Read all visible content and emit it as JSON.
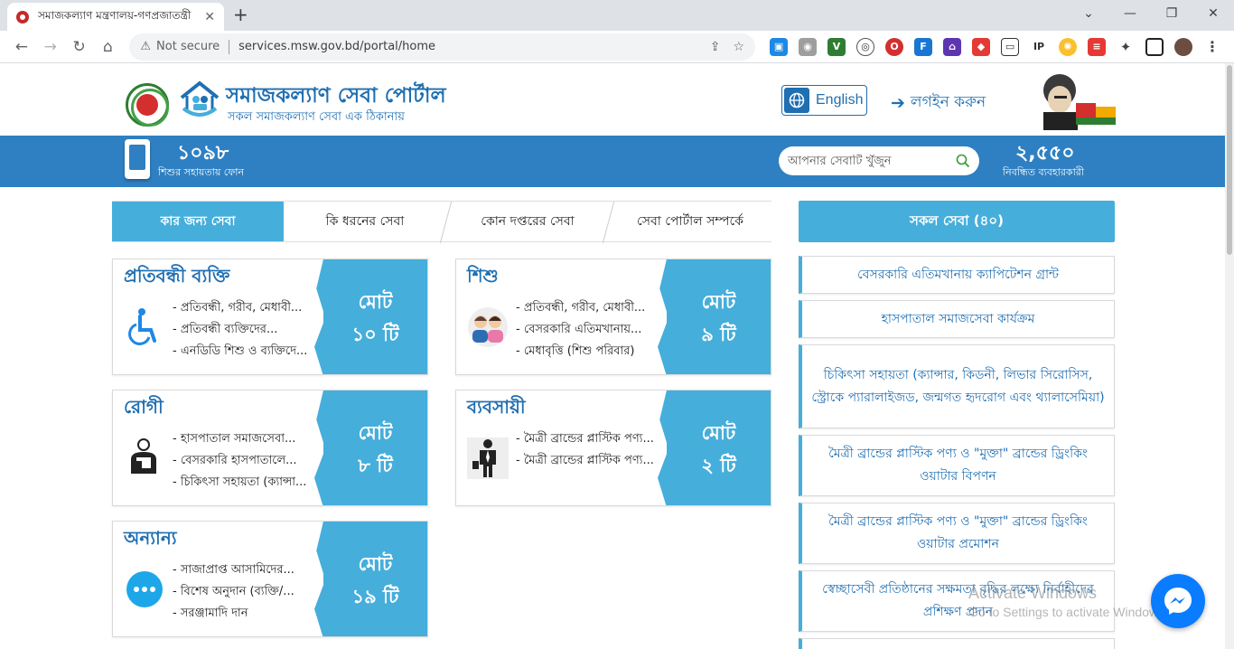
{
  "browser": {
    "tab_title": "সমাজকল্যাণ মন্ত্রণালয়-গণপ্রজাতন্ত্রী",
    "security_label": "Not secure",
    "url": "services.msw.gov.bd/portal/home"
  },
  "header": {
    "site_title": "সমাজকল্যাণ সেবা পোর্টাল",
    "site_subtitle": "সকল সমাজকল্যাণ সেবা এক ঠিকানায়",
    "language_button": "English",
    "login_label": "লগইন করুন"
  },
  "infobar": {
    "helpline_number": "১০৯৮",
    "helpline_label": "শিশুর সহায়তায় ফোন",
    "search_placeholder": "আপনার সেবাটি খুঁজুন",
    "registered_count": "২,৫৫০",
    "registered_label": "নিবন্ধিত ব্যবহারকারী"
  },
  "tabs": [
    {
      "label": "কার জন্য সেবা",
      "active": true
    },
    {
      "label": "কি ধরনের সেবা",
      "active": false
    },
    {
      "label": "কোন দপ্তরের সেবা",
      "active": false
    },
    {
      "label": "সেবা পোর্টাল সম্পর্কে",
      "active": false
    }
  ],
  "categories": [
    {
      "title": "প্রতিবন্ধী ব্যক্তি",
      "icon": "wheelchair-icon",
      "items": [
        "- প্রতিবন্ধী, গরীব, মেধাবী...",
        "- প্রতিবন্ধী ব্যক্তিদের...",
        "- এনডিডি শিশু ও ব্যক্তিদে..."
      ],
      "total_label": "মোট",
      "total_count": "১০ টি"
    },
    {
      "title": "শিশু",
      "icon": "children-icon",
      "items": [
        "- প্রতিবন্ধী, গরীব, মেধাবী...",
        "- বেসরকারি এতিমখানায়...",
        "- মেধাবৃত্তি (শিশু পরিবার)"
      ],
      "total_label": "মোট",
      "total_count": "৯ টি"
    },
    {
      "title": "রোগী",
      "icon": "patient-icon",
      "items": [
        "- হাসপাতাল সমাজসেবা...",
        "- বেসরকারি হাসপাতালে...",
        "- চিকিৎসা সহায়তা (ক্যান্সা..."
      ],
      "total_label": "মোট",
      "total_count": "৮ টি"
    },
    {
      "title": "ব্যবসায়ী",
      "icon": "businessman-icon",
      "items": [
        "- মৈত্রী ব্রান্ডের প্লাস্টিক পণ্য...",
        "- মৈত্রী ব্রান্ডের প্লাস্টিক পণ্য..."
      ],
      "total_label": "মোট",
      "total_count": "২ টি"
    },
    {
      "title": "অন্যান্য",
      "icon": "more-icon",
      "items": [
        "- সাজাপ্রাপ্ত আসামিদের...",
        "- বিশেষ অনুদান (ব্যক্তি/...",
        "- সরঞ্জামাদি দান"
      ],
      "total_label": "মোট",
      "total_count": "১৯ টি"
    }
  ],
  "all_services": {
    "header": "সকল সেবা (৪০)",
    "items": [
      "বেসরকারি এতিমখানায় ক্যাপিটেশন গ্রান্ট",
      "হাসপাতাল সমাজসেবা কার্যক্রম",
      "চিকিৎসা সহায়তা (ক্যান্সার, কিডনী, লিভার সিরোসিস, স্ট্রোকে প্যারালাইজড, জন্মগত হৃদরোগ এবং থ্যালাসেমিয়া)",
      "মৈত্রী ব্রান্ডের প্লাস্টিক পণ্য ও \"মুক্তা\" ব্রান্ডের ড্রিংকিং ওয়াটার বিপণন",
      "মৈত্রী ব্রান্ডের প্লাস্টিক পণ্য ও \"মুক্তা\" ব্রান্ডের ড্রিংকিং ওয়াটার প্রমোশন",
      "স্বেচ্ছাসেবী প্রতিষ্ঠানের সক্ষমতা বৃদ্ধির লক্ষ্যে নির্বাহীদের প্রশিক্ষণ প্রদান"
    ]
  },
  "watermark": {
    "line1": "Activate Windows",
    "line2": "Go to Settings to activate Windows."
  },
  "colors": {
    "brand_blue": "#2f80c2",
    "accent_cyan": "#46aedb",
    "title_blue": "#1f6fb2"
  }
}
